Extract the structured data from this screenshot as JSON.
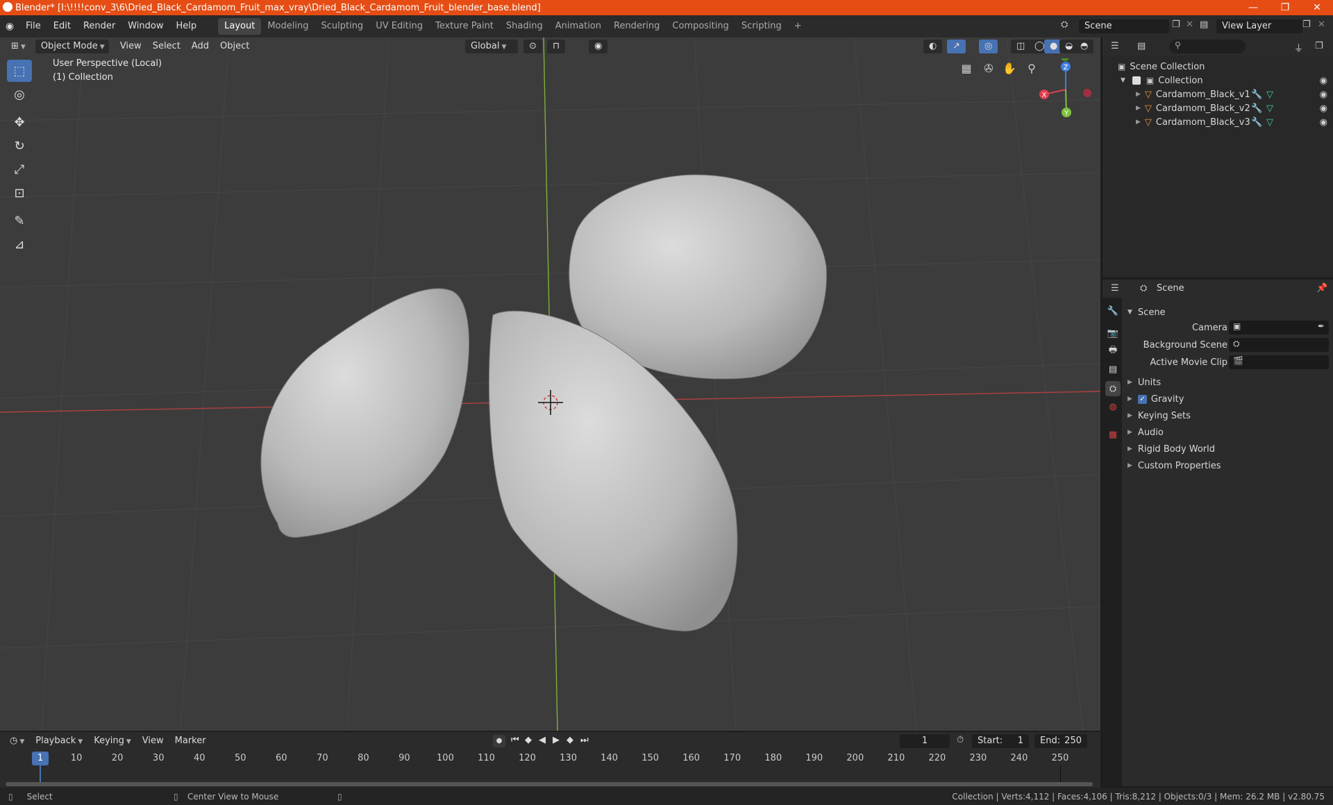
{
  "window": {
    "title": "Blender* [I:\\!!!!conv_3\\6\\Dried_Black_Cardamom_Fruit_max_vray\\Dried_Black_Cardamom_Fruit_blender_base.blend]",
    "minimize": "—",
    "maximize": "❐",
    "close": "✕"
  },
  "menubar": {
    "items": [
      "File",
      "Edit",
      "Render",
      "Window",
      "Help"
    ],
    "workspaces": [
      "Layout",
      "Modeling",
      "Sculpting",
      "UV Editing",
      "Texture Paint",
      "Shading",
      "Animation",
      "Rendering",
      "Compositing",
      "Scripting"
    ],
    "active_workspace": "Layout",
    "add_workspace": "+",
    "scene_name": "Scene",
    "view_layer": "View Layer"
  },
  "viewport": {
    "mode": "Object Mode",
    "menus": [
      "View",
      "Select",
      "Add",
      "Object"
    ],
    "transform_orientation": "Global",
    "perspective_label": "User Perspective (Local)",
    "collection_label": "(1) Collection",
    "axis_labels": {
      "x": "X",
      "y": "Y",
      "z": "Z"
    },
    "colors": {
      "background": "#3c3c3c",
      "x_axis": "#b04040",
      "y_axis": "#7fb03a",
      "mesh": "#bcbcbc"
    }
  },
  "tools": [
    {
      "name": "select-box-tool",
      "glyph": "⬚",
      "active": true
    },
    {
      "name": "cursor-tool",
      "glyph": "◎",
      "active": false
    },
    {
      "name": "move-tool",
      "glyph": "✥",
      "active": false
    },
    {
      "name": "rotate-tool",
      "glyph": "↻",
      "active": false
    },
    {
      "name": "scale-tool",
      "glyph": "⤢",
      "active": false
    },
    {
      "name": "transform-tool",
      "glyph": "⊡",
      "active": false
    },
    {
      "name": "annotate-tool",
      "glyph": "✎",
      "active": false
    },
    {
      "name": "measure-tool",
      "glyph": "📐",
      "active": false
    }
  ],
  "outliner": {
    "root": "Scene Collection",
    "collection": "Collection",
    "objects": [
      "Cardamom_Black_v1",
      "Cardamom_Black_v2",
      "Cardamom_Black_v3"
    ]
  },
  "properties": {
    "context": "Scene",
    "panel_title": "Scene",
    "fields": [
      {
        "label": "Camera",
        "value": ""
      },
      {
        "label": "Background Scene",
        "value": ""
      },
      {
        "label": "Active Movie Clip",
        "value": ""
      }
    ],
    "sections": [
      "Units",
      "Gravity",
      "Keying Sets",
      "Audio",
      "Rigid Body World",
      "Custom Properties"
    ],
    "gravity_checked": true
  },
  "timeline": {
    "menus": [
      "Playback",
      "Keying",
      "View",
      "Marker"
    ],
    "current_frame": "1",
    "start_label": "Start:",
    "start": "1",
    "end_label": "End:",
    "end": "250",
    "ticks": [
      "10",
      "20",
      "30",
      "40",
      "50",
      "60",
      "70",
      "80",
      "90",
      "100",
      "110",
      "120",
      "130",
      "140",
      "150",
      "160",
      "170",
      "180",
      "190",
      "200",
      "210",
      "220",
      "230",
      "240",
      "250"
    ],
    "playhead": "1"
  },
  "statusbar": {
    "left": "Select",
    "middle": "Center View to Mouse",
    "right": "Collection | Verts:4,112 | Faces:4,106 | Tris:8,212 | Objects:0/3 | Mem: 26.2 MB | v2.80.75"
  }
}
